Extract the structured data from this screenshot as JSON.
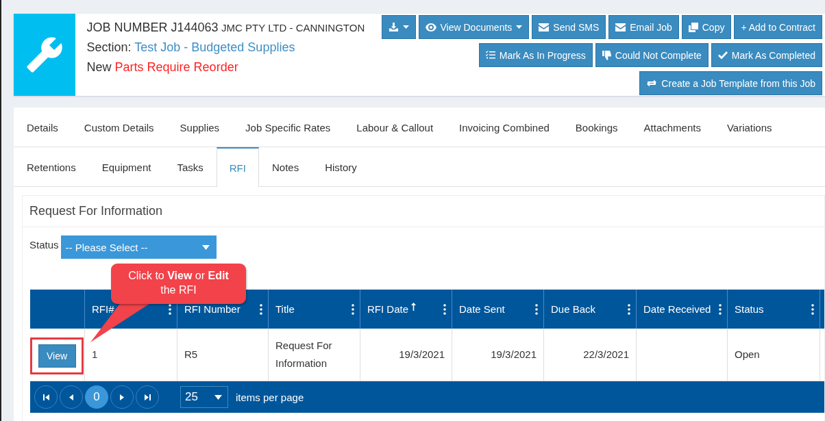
{
  "header": {
    "job_number": "JOB NUMBER J144063",
    "company": "JMC PTY LTD - CANNINGTON",
    "section_label": "Section:",
    "section_value": "Test Job - Budgeted Supplies",
    "status_label": "New",
    "status_value": "Parts Require Reorder"
  },
  "toolbar_rows": [
    [
      {
        "kind": "download",
        "caret": true
      },
      {
        "kind": "documents",
        "label": "View Documents",
        "caret": true
      },
      {
        "kind": "sms",
        "label": "Send SMS",
        "caret": false
      },
      {
        "kind": "email",
        "label": "Email Job",
        "caret": false
      },
      {
        "kind": "copy",
        "label": "Copy",
        "caret": false
      },
      {
        "kind": "plain",
        "label": "+ Add to Contract",
        "caret": false
      }
    ],
    [
      {
        "kind": "progress",
        "label": "Mark As In Progress",
        "caret": false
      },
      {
        "kind": "fail",
        "label": "Could Not Complete",
        "caret": false
      },
      {
        "kind": "complete",
        "label": "Mark As Completed",
        "caret": false
      }
    ],
    [
      {
        "kind": "template",
        "label": "Create a Job Template from this Job",
        "caret": false
      }
    ]
  ],
  "tab_rows": [
    [
      {
        "label": "Details",
        "selected": false
      },
      {
        "label": "Custom Details",
        "selected": false
      },
      {
        "label": "Supplies",
        "selected": false
      },
      {
        "label": "Job Specific Rates",
        "selected": false
      },
      {
        "label": "Labour & Callout",
        "selected": false
      },
      {
        "label": "Invoicing Combined",
        "selected": false
      },
      {
        "label": "Bookings",
        "selected": false
      },
      {
        "label": "Attachments",
        "selected": false
      },
      {
        "label": "Variations",
        "selected": false
      }
    ],
    [
      {
        "label": "Retentions",
        "selected": false
      },
      {
        "label": "Equipment",
        "selected": false
      },
      {
        "label": "Tasks",
        "selected": false
      },
      {
        "label": "RFI",
        "selected": true
      },
      {
        "label": "Notes",
        "selected": false
      },
      {
        "label": "History",
        "selected": false
      }
    ]
  ],
  "rfi_panel": {
    "title": "Request For Information",
    "filter": {
      "label": "Status",
      "value": "-- Please Select --"
    },
    "table": {
      "columns": [
        {
          "label": "RFI#",
          "sorted": false,
          "kind": "text"
        },
        {
          "label": "RFI Number",
          "sorted": false,
          "kind": "text"
        },
        {
          "label": "Title",
          "sorted": false,
          "kind": "text"
        },
        {
          "label": "RFI Date",
          "sorted": true,
          "kind": "date"
        },
        {
          "label": "Date Sent",
          "sorted": false,
          "kind": "date"
        },
        {
          "label": "Due Back",
          "sorted": false,
          "kind": "date"
        },
        {
          "label": "Date Received",
          "sorted": false,
          "kind": "date"
        },
        {
          "label": "Status",
          "sorted": false,
          "kind": "text"
        }
      ],
      "rows": [
        {
          "action": "View",
          "highlighted": true,
          "cells": [
            "1",
            "R5",
            "Request For Information",
            "19/3/2021",
            "19/3/2021",
            "22/3/2021",
            null,
            "Open"
          ]
        }
      ]
    },
    "pager": {
      "page": "0",
      "page_size": "25",
      "items_label": "items per page"
    }
  },
  "callout": {
    "text": "Click to **View** or **Edit** the RFI"
  }
}
